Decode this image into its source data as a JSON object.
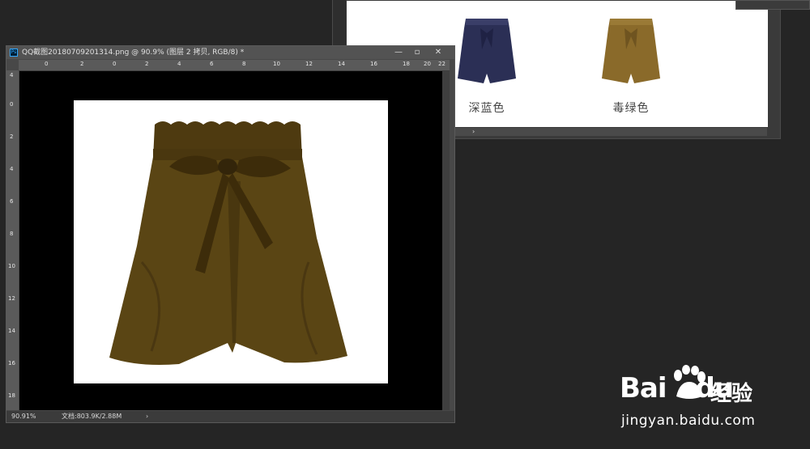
{
  "background_window": {
    "swatches": [
      {
        "caption": "深蓝色",
        "color": "#2b2f55"
      },
      {
        "caption": "毒绿色",
        "color": "#8a6a2a"
      }
    ],
    "scroll_arrow": "›"
  },
  "document": {
    "title": "QQ截图20180709201314.png @ 90.9% (图层 2 拷贝, RGB/8) *",
    "buttons": {
      "minimize": "—",
      "maximize": "▫",
      "close": "✕"
    },
    "ruler_h_ticks": [
      "0",
      "2",
      "0",
      "2",
      "4",
      "6",
      "8",
      "10",
      "12",
      "14",
      "16",
      "18",
      "20",
      "22"
    ],
    "ruler_v_ticks": [
      "4",
      "0",
      "2",
      "4",
      "6",
      "8",
      "10",
      "12",
      "14",
      "16",
      "18"
    ],
    "status": {
      "zoom": "90.91%",
      "doc_size": "文档:803.9K/2.88M",
      "arrow": "›"
    },
    "image": {
      "subject": "shorts-with-belt",
      "color": "#5a4514"
    }
  },
  "watermark": {
    "brand": "Bai",
    "brand_suffix": "du",
    "cn": "经验",
    "url": "jingyan.baidu.com"
  },
  "colors": {
    "app_bg": "#252525",
    "panel": "#484848",
    "canvas": "#000000"
  }
}
